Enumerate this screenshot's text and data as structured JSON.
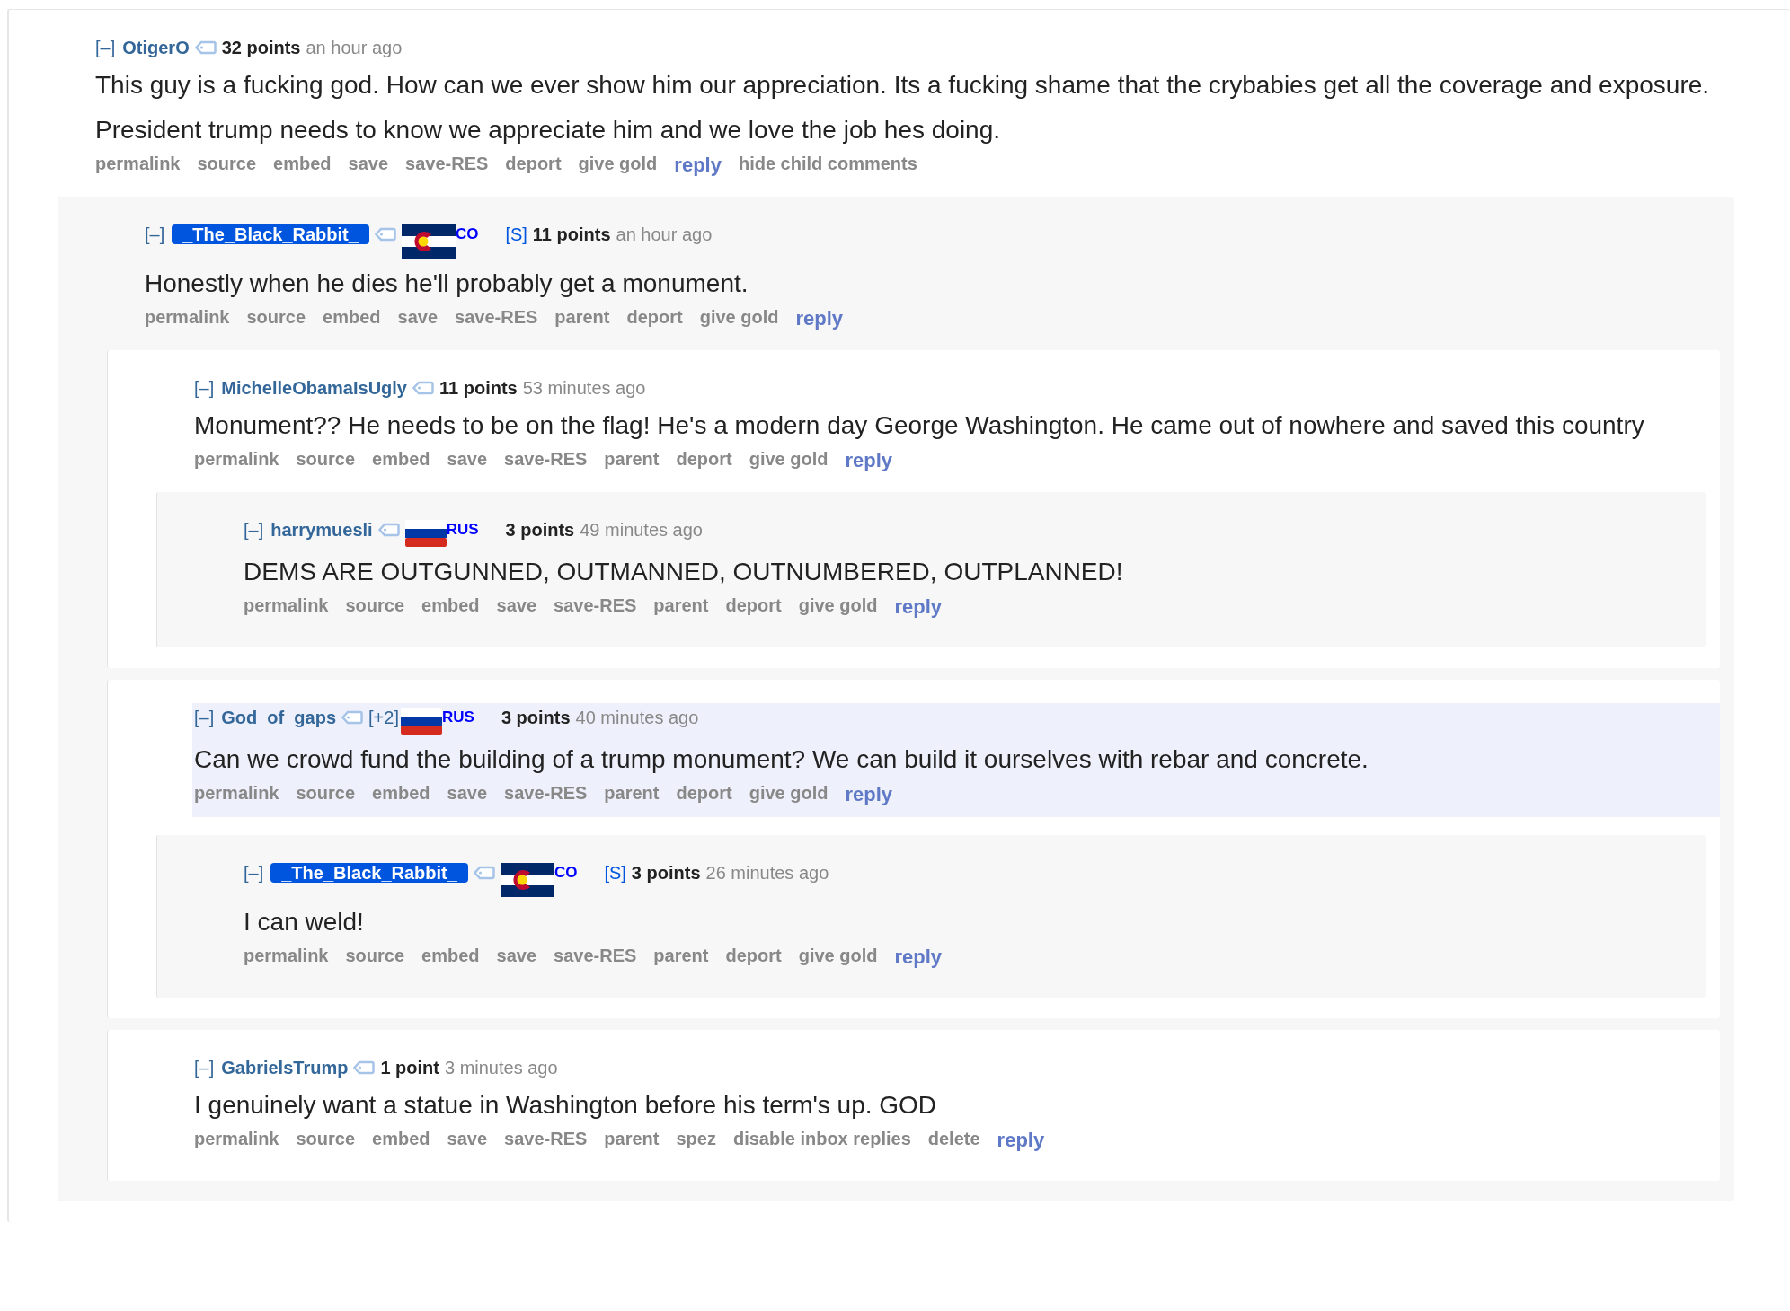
{
  "thread": [
    {
      "collapse": "[–]",
      "author": "OtigerO",
      "submitter": false,
      "score": "32 points",
      "time": "an hour ago",
      "highlighted": false,
      "body": [
        "This guy is a fucking god. How can we ever show him our appreciation. Its a fucking shame that the crybabies get all the coverage and exposure.",
        "President trump needs to know we appreciate him and we love the job hes doing."
      ],
      "actions": [
        {
          "label": "permalink",
          "kind": "plain"
        },
        {
          "label": "source",
          "kind": "plain"
        },
        {
          "label": "embed",
          "kind": "plain"
        },
        {
          "label": "save",
          "kind": "plain"
        },
        {
          "label": "save-RES",
          "kind": "plain"
        },
        {
          "label": "deport",
          "kind": "plain"
        },
        {
          "label": "give gold",
          "kind": "plain"
        },
        {
          "label": "reply",
          "kind": "reply"
        },
        {
          "label": "hide child comments",
          "kind": "plain"
        }
      ],
      "children": [
        {
          "collapse": "[–]",
          "author": "_The_Black_Rabbit_",
          "submitter": true,
          "flair": {
            "kind": "colorado",
            "text": "CO"
          },
          "submitter_tag": "[S]",
          "score": "11 points",
          "time": "an hour ago",
          "highlighted": false,
          "body": [
            "Honestly when he dies he'll probably get a monument."
          ],
          "actions": [
            {
              "label": "permalink",
              "kind": "plain"
            },
            {
              "label": "source",
              "kind": "plain"
            },
            {
              "label": "embed",
              "kind": "plain"
            },
            {
              "label": "save",
              "kind": "plain"
            },
            {
              "label": "save-RES",
              "kind": "plain"
            },
            {
              "label": "parent",
              "kind": "plain"
            },
            {
              "label": "deport",
              "kind": "plain"
            },
            {
              "label": "give gold",
              "kind": "plain"
            },
            {
              "label": "reply",
              "kind": "reply"
            }
          ],
          "children": [
            {
              "collapse": "[–]",
              "author": "MichelleObamaIsUgly",
              "submitter": false,
              "score": "11 points",
              "time": "53 minutes ago",
              "highlighted": false,
              "body": [
                "Monument?? He needs to be on the flag! He's a modern day George Washington. He came out of nowhere and saved this country"
              ],
              "actions": [
                {
                  "label": "permalink",
                  "kind": "plain"
                },
                {
                  "label": "source",
                  "kind": "plain"
                },
                {
                  "label": "embed",
                  "kind": "plain"
                },
                {
                  "label": "save",
                  "kind": "plain"
                },
                {
                  "label": "save-RES",
                  "kind": "plain"
                },
                {
                  "label": "parent",
                  "kind": "plain"
                },
                {
                  "label": "deport",
                  "kind": "plain"
                },
                {
                  "label": "give gold",
                  "kind": "plain"
                },
                {
                  "label": "reply",
                  "kind": "reply"
                }
              ],
              "children": [
                {
                  "collapse": "[–]",
                  "author": "harrymuesli",
                  "submitter": false,
                  "flair": {
                    "kind": "russia",
                    "text": "RUS"
                  },
                  "score": "3 points",
                  "time": "49 minutes ago",
                  "highlighted": false,
                  "body": [
                    "DEMS ARE OUTGUNNED, OUTMANNED, OUTNUMBERED, OUTPLANNED!"
                  ],
                  "actions": [
                    {
                      "label": "permalink",
                      "kind": "plain"
                    },
                    {
                      "label": "source",
                      "kind": "plain"
                    },
                    {
                      "label": "embed",
                      "kind": "plain"
                    },
                    {
                      "label": "save",
                      "kind": "plain"
                    },
                    {
                      "label": "save-RES",
                      "kind": "plain"
                    },
                    {
                      "label": "parent",
                      "kind": "plain"
                    },
                    {
                      "label": "deport",
                      "kind": "plain"
                    },
                    {
                      "label": "give gold",
                      "kind": "plain"
                    },
                    {
                      "label": "reply",
                      "kind": "reply"
                    }
                  ]
                }
              ]
            },
            {
              "collapse": "[–]",
              "author": "God_of_gaps",
              "submitter": false,
              "vote_tag": "[+2]",
              "flair": {
                "kind": "russia",
                "text": "RUS"
              },
              "score": "3 points",
              "time": "40 minutes ago",
              "highlighted": true,
              "body": [
                "Can we crowd fund the building of a trump monument? We can build it ourselves with rebar and concrete."
              ],
              "actions": [
                {
                  "label": "permalink",
                  "kind": "plain"
                },
                {
                  "label": "source",
                  "kind": "plain"
                },
                {
                  "label": "embed",
                  "kind": "plain"
                },
                {
                  "label": "save",
                  "kind": "plain"
                },
                {
                  "label": "save-RES",
                  "kind": "plain"
                },
                {
                  "label": "parent",
                  "kind": "plain"
                },
                {
                  "label": "deport",
                  "kind": "plain"
                },
                {
                  "label": "give gold",
                  "kind": "plain"
                },
                {
                  "label": "reply",
                  "kind": "reply"
                }
              ],
              "children": [
                {
                  "collapse": "[–]",
                  "author": "_The_Black_Rabbit_",
                  "submitter": true,
                  "flair": {
                    "kind": "colorado",
                    "text": "CO"
                  },
                  "submitter_tag": "[S]",
                  "score": "3 points",
                  "time": "26 minutes ago",
                  "highlighted": false,
                  "body": [
                    "I can weld!"
                  ],
                  "actions": [
                    {
                      "label": "permalink",
                      "kind": "plain"
                    },
                    {
                      "label": "source",
                      "kind": "plain"
                    },
                    {
                      "label": "embed",
                      "kind": "plain"
                    },
                    {
                      "label": "save",
                      "kind": "plain"
                    },
                    {
                      "label": "save-RES",
                      "kind": "plain"
                    },
                    {
                      "label": "parent",
                      "kind": "plain"
                    },
                    {
                      "label": "deport",
                      "kind": "plain"
                    },
                    {
                      "label": "give gold",
                      "kind": "plain"
                    },
                    {
                      "label": "reply",
                      "kind": "reply"
                    }
                  ]
                }
              ]
            },
            {
              "collapse": "[–]",
              "author": "GabrielsTrump",
              "submitter": false,
              "score": "1 point",
              "time": "3 minutes ago",
              "highlighted": false,
              "body": [
                "I genuinely want a statue in Washington before his term's up. GOD"
              ],
              "actions": [
                {
                  "label": "permalink",
                  "kind": "plain"
                },
                {
                  "label": "source",
                  "kind": "plain"
                },
                {
                  "label": "embed",
                  "kind": "plain"
                },
                {
                  "label": "save",
                  "kind": "plain"
                },
                {
                  "label": "save-RES",
                  "kind": "plain"
                },
                {
                  "label": "parent",
                  "kind": "plain"
                },
                {
                  "label": "spez",
                  "kind": "plain"
                },
                {
                  "label": "disable inbox replies",
                  "kind": "plain"
                },
                {
                  "label": "delete",
                  "kind": "plain"
                },
                {
                  "label": "reply",
                  "kind": "reply"
                }
              ]
            }
          ]
        }
      ]
    }
  ]
}
